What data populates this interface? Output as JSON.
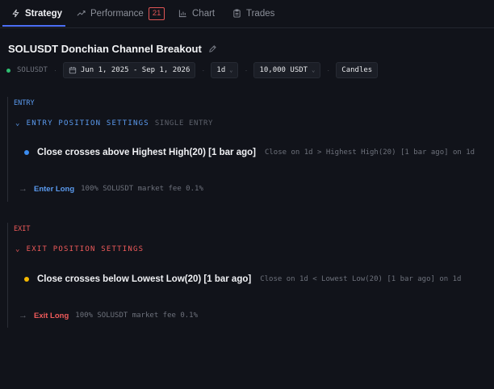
{
  "tabs": [
    {
      "label": "Strategy"
    },
    {
      "label": "Performance",
      "badge": "21"
    },
    {
      "label": "Chart"
    },
    {
      "label": "Trades"
    }
  ],
  "strategy": {
    "title": "SOLUSDT Donchian Channel Breakout",
    "symbol": "SOLUSDT",
    "date_range": "Jun 1, 2025 - Sep 1, 2026",
    "timeframe": "1d",
    "capital": "10,000 USDT",
    "view": "Candles"
  },
  "entry": {
    "label": "ENTRY",
    "header": "ENTRY POSITION SETTINGS",
    "sub": "SINGLE ENTRY",
    "condition": "Close crosses above Highest High(20) [1 bar ago]",
    "condition_detail": "Close on 1d > Highest High(20) [1 bar ago] on 1d",
    "action_label": "Enter Long",
    "action_desc": "100% SOLUSDT market fee 0.1%"
  },
  "exit": {
    "label": "EXIT",
    "header": "EXIT POSITION SETTINGS",
    "condition": "Close crosses below Lowest Low(20) [1 bar ago]",
    "condition_detail": "Close on 1d < Lowest Low(20) [1 bar ago] on 1d",
    "action_label": "Exit Long",
    "action_desc": "100% SOLUSDT market fee 0.1%"
  },
  "colors": {
    "entry": "#5b9bf0",
    "exit": "#ef5a5a",
    "entry_bullet": "#3b8cf0",
    "exit_bullet": "#f5b800",
    "status_green": "#2fbf71",
    "tab_underline": "#4c6ef5"
  },
  "icons": [
    "lightning-icon",
    "trend-icon",
    "bar-chart-icon",
    "clipboard-icon",
    "pencil-icon",
    "calendar-icon",
    "chevron-down-icon",
    "arrow-right-icon"
  ]
}
